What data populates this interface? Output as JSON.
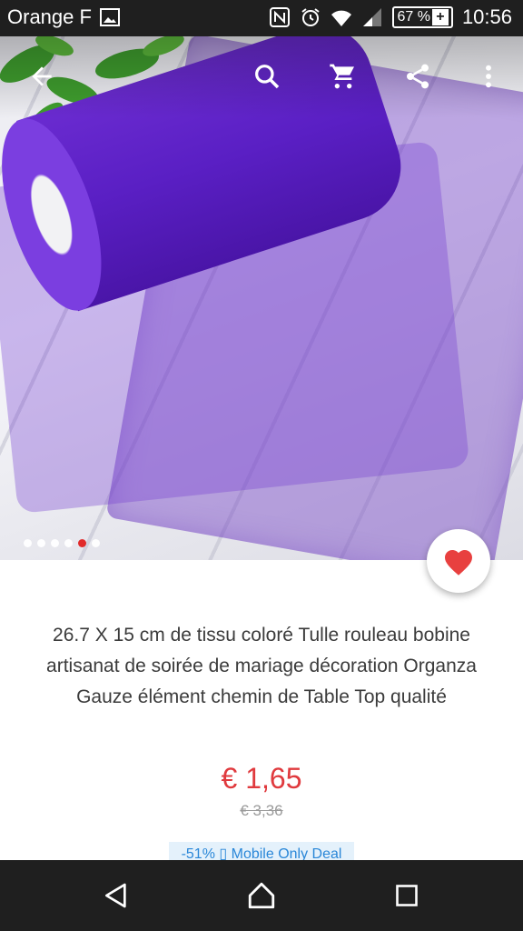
{
  "status_bar": {
    "carrier": "Orange F",
    "icons": [
      "image-icon",
      "nfc-icon",
      "alarm-icon",
      "wifi-icon",
      "signal-icon"
    ],
    "battery": "67 %",
    "battery_plus": "+",
    "time": "10:56"
  },
  "toolbar": {
    "icons": [
      "back-arrow-icon",
      "search-icon",
      "cart-icon",
      "share-icon",
      "more-vert-icon"
    ]
  },
  "carousel": {
    "count": 6,
    "active_index": 4
  },
  "product": {
    "title": "26.7 X 15 cm de tissu coloré Tulle rouleau bobine artisanat de soirée de mariage décoration Organza Gauze élément chemin de Table Top qualité",
    "price": "€ 1,65",
    "original_price": "€ 3,36",
    "deal_label": "-51% ▯ Mobile Only Deal"
  },
  "colors": {
    "price": "#e03a3e",
    "deal_text": "#2a87d8",
    "deal_bg": "#e4f1fb",
    "heart": "#e8403f",
    "bars": "#1f1f1f"
  },
  "navbar": {
    "icons": [
      "nav-back-icon",
      "nav-home-icon",
      "nav-recents-icon"
    ]
  }
}
